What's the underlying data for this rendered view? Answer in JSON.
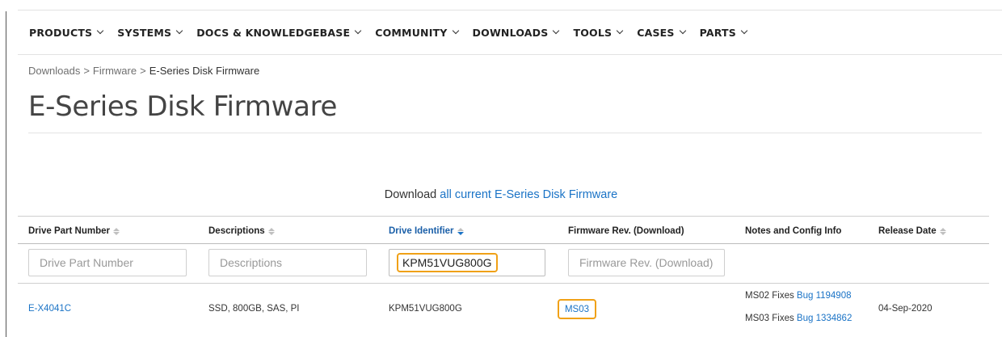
{
  "nav": {
    "items": [
      {
        "label": "PRODUCTS"
      },
      {
        "label": "SYSTEMS"
      },
      {
        "label": "DOCS & KNOWLEDGEBASE"
      },
      {
        "label": "COMMUNITY"
      },
      {
        "label": "DOWNLOADS"
      },
      {
        "label": "TOOLS"
      },
      {
        "label": "CASES"
      },
      {
        "label": "PARTS"
      }
    ]
  },
  "breadcrumb": {
    "items": [
      "Downloads",
      "Firmware",
      "E-Series Disk Firmware"
    ],
    "separator": ">"
  },
  "page": {
    "title": "E-Series Disk Firmware",
    "download_prefix": "Download",
    "download_link": "all current E-Series Disk Firmware"
  },
  "table": {
    "headers": [
      "Drive Part Number",
      "Descriptions",
      "Drive Identifier",
      "Firmware Rev. (Download)",
      "Notes and Config Info",
      "Release Date"
    ],
    "filters": {
      "part_number_placeholder": "Drive Part Number",
      "descriptions_placeholder": "Descriptions",
      "drive_identifier_value": "KPM51VUG800G",
      "firmware_placeholder": "Firmware Rev. (Download)"
    },
    "rows": [
      {
        "part_number": "E-X4041C",
        "description": "SSD, 800GB, SAS, PI",
        "drive_identifier": "KPM51VUG800G",
        "firmware": "MS03",
        "notes": [
          {
            "text": "MS02 Fixes",
            "link": "Bug 1194908"
          },
          {
            "text": "MS03 Fixes",
            "link": "Bug 1334862"
          }
        ],
        "release_date": "04-Sep-2020"
      }
    ]
  },
  "colors": {
    "link": "#1a73c6",
    "highlight": "#f0a117",
    "sorted_header": "#1a5fa8"
  }
}
